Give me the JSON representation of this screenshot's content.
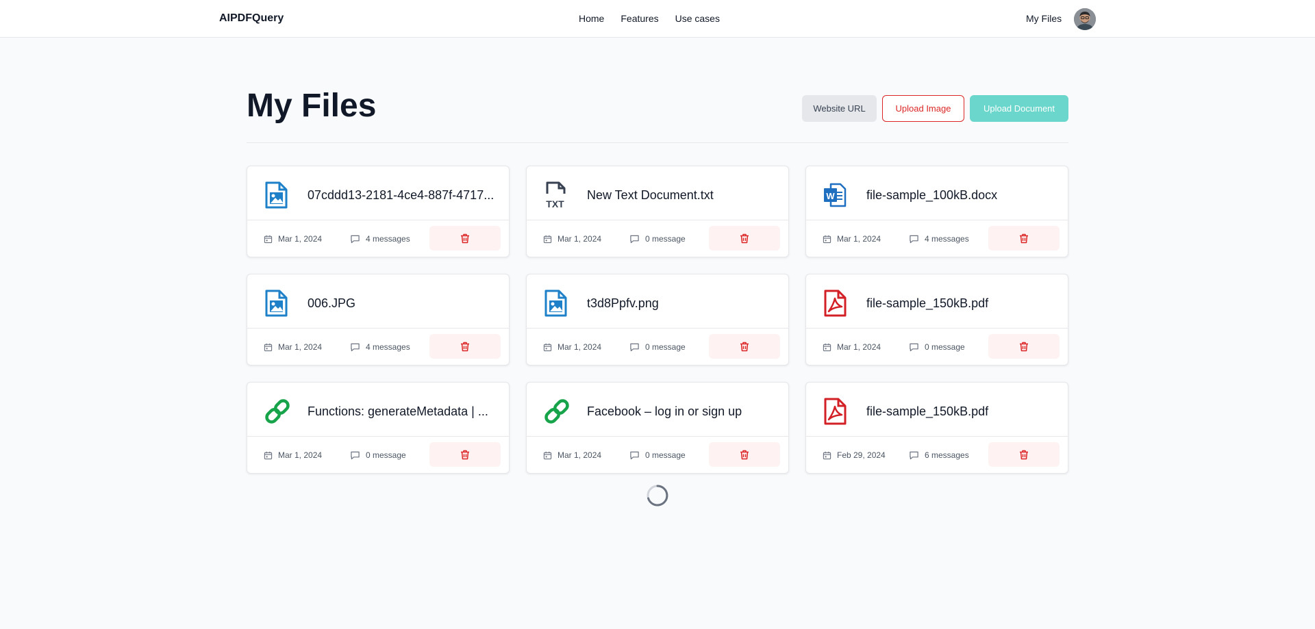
{
  "nav": {
    "brand": "AIPDFQuery",
    "links": [
      "Home",
      "Features",
      "Use cases"
    ],
    "my_files": "My Files"
  },
  "page": {
    "title": "My Files"
  },
  "actions": {
    "website_url": "Website URL",
    "upload_image": "Upload Image",
    "upload_document": "Upload Document"
  },
  "colors": {
    "accent_teal": "#6ad6cc",
    "danger_red": "#dc2626",
    "image_blue": "#1e80c8",
    "link_green": "#16a34a",
    "pdf_red": "#d32027",
    "word_blue": "#1e6fc0"
  },
  "files": [
    {
      "name": "07cddd13-2181-4ce4-887f-4717...",
      "icon": "image-file-icon",
      "date": "Mar 1, 2024",
      "messages": "4 messages"
    },
    {
      "name": "New Text Document.txt",
      "icon": "txt-file-icon",
      "date": "Mar 1, 2024",
      "messages": "0 message"
    },
    {
      "name": "file-sample_100kB.docx",
      "icon": "word-file-icon",
      "date": "Mar 1, 2024",
      "messages": "4 messages"
    },
    {
      "name": "006.JPG",
      "icon": "image-file-icon",
      "date": "Mar 1, 2024",
      "messages": "4 messages"
    },
    {
      "name": "t3d8Ppfv.png",
      "icon": "image-file-icon",
      "date": "Mar 1, 2024",
      "messages": "0 message"
    },
    {
      "name": "file-sample_150kB.pdf",
      "icon": "pdf-file-icon",
      "date": "Mar 1, 2024",
      "messages": "0 message"
    },
    {
      "name": "Functions: generateMetadata | ...",
      "icon": "link-icon",
      "date": "Mar 1, 2024",
      "messages": "0 message"
    },
    {
      "name": "Facebook – log in or sign up",
      "icon": "link-icon",
      "date": "Mar 1, 2024",
      "messages": "0 message"
    },
    {
      "name": "file-sample_150kB.pdf",
      "icon": "pdf-file-icon",
      "date": "Feb 29, 2024",
      "messages": "6 messages"
    }
  ]
}
